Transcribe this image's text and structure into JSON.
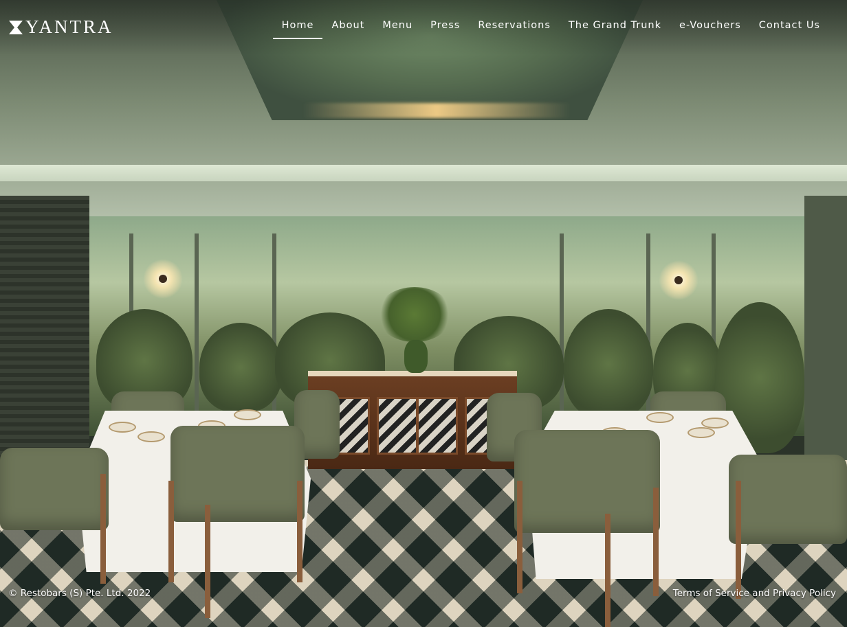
{
  "brand": {
    "name": "YANTRA",
    "logo_icon": "hourglass-mark"
  },
  "nav": {
    "items": [
      {
        "label": "Home",
        "active": true
      },
      {
        "label": "About"
      },
      {
        "label": "Menu"
      },
      {
        "label": "Press"
      },
      {
        "label": "Reservations"
      },
      {
        "label": "The Grand Trunk"
      },
      {
        "label": "e-Vouchers"
      },
      {
        "label": "Contact Us"
      }
    ]
  },
  "hero": {
    "image_subject": "restaurant-dining-room-photo"
  },
  "footer": {
    "copyright": "© Restobars (S) Pte. Ltd. 2022",
    "legal_link": "Terms of Service and Privacy Policy"
  },
  "colors": {
    "nav_text": "#ffffff",
    "active_underline": "#ffffff"
  }
}
